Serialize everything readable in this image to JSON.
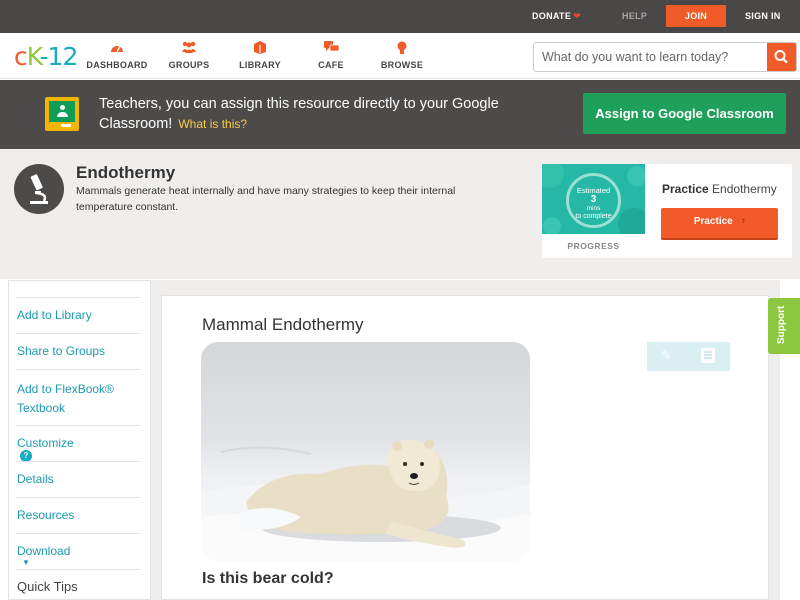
{
  "topbar": {
    "donate": "DONATE",
    "help": "HELP",
    "join": "JOIN",
    "signin": "SIGN IN"
  },
  "nav": {
    "logo": {
      "c": "c",
      "k": "K",
      "rest": "-12"
    },
    "items": [
      {
        "label": "DASHBOARD",
        "icon": "dashboard-icon"
      },
      {
        "label": "GROUPS",
        "icon": "groups-icon"
      },
      {
        "label": "LIBRARY",
        "icon": "library-icon"
      },
      {
        "label": "CAFE",
        "icon": "cafe-icon"
      },
      {
        "label": "BROWSE",
        "icon": "browse-icon"
      }
    ],
    "search_placeholder": "What do you want to learn today?"
  },
  "banner": {
    "text": "Teachers, you can assign this resource directly to your Google Classroom!",
    "link": "What is this?",
    "button": "Assign to Google Classroom"
  },
  "concept": {
    "title": "Endothermy",
    "description": "Mammals generate heat internally and have many strategies to keep their internal temperature constant.",
    "practice": {
      "heading_bold": "Practice",
      "heading_rest": "Endothermy",
      "button": "Practice",
      "progress_label": "PROGRESS",
      "estimate": {
        "line1": "Estimated",
        "num": "3",
        "line3": "mins",
        "line4": "to complete"
      }
    }
  },
  "sidebar": {
    "items": [
      {
        "label": "Add to Library"
      },
      {
        "label": "Share to Groups"
      },
      {
        "label": "Add to FlexBook® Textbook"
      },
      {
        "label": "Customize"
      },
      {
        "label": "Details"
      },
      {
        "label": "Resources"
      },
      {
        "label": "Download"
      },
      {
        "label": "Quick Tips"
      }
    ],
    "help_badge": "?"
  },
  "content": {
    "title": "Mammal Endothermy",
    "question": "Is this bear cold?",
    "support": "Support"
  },
  "colors": {
    "brand_orange": "#f15a29",
    "brand_green": "#8dc63f",
    "brand_teal": "#1aabc4",
    "classroom_green": "#1fa05a"
  }
}
